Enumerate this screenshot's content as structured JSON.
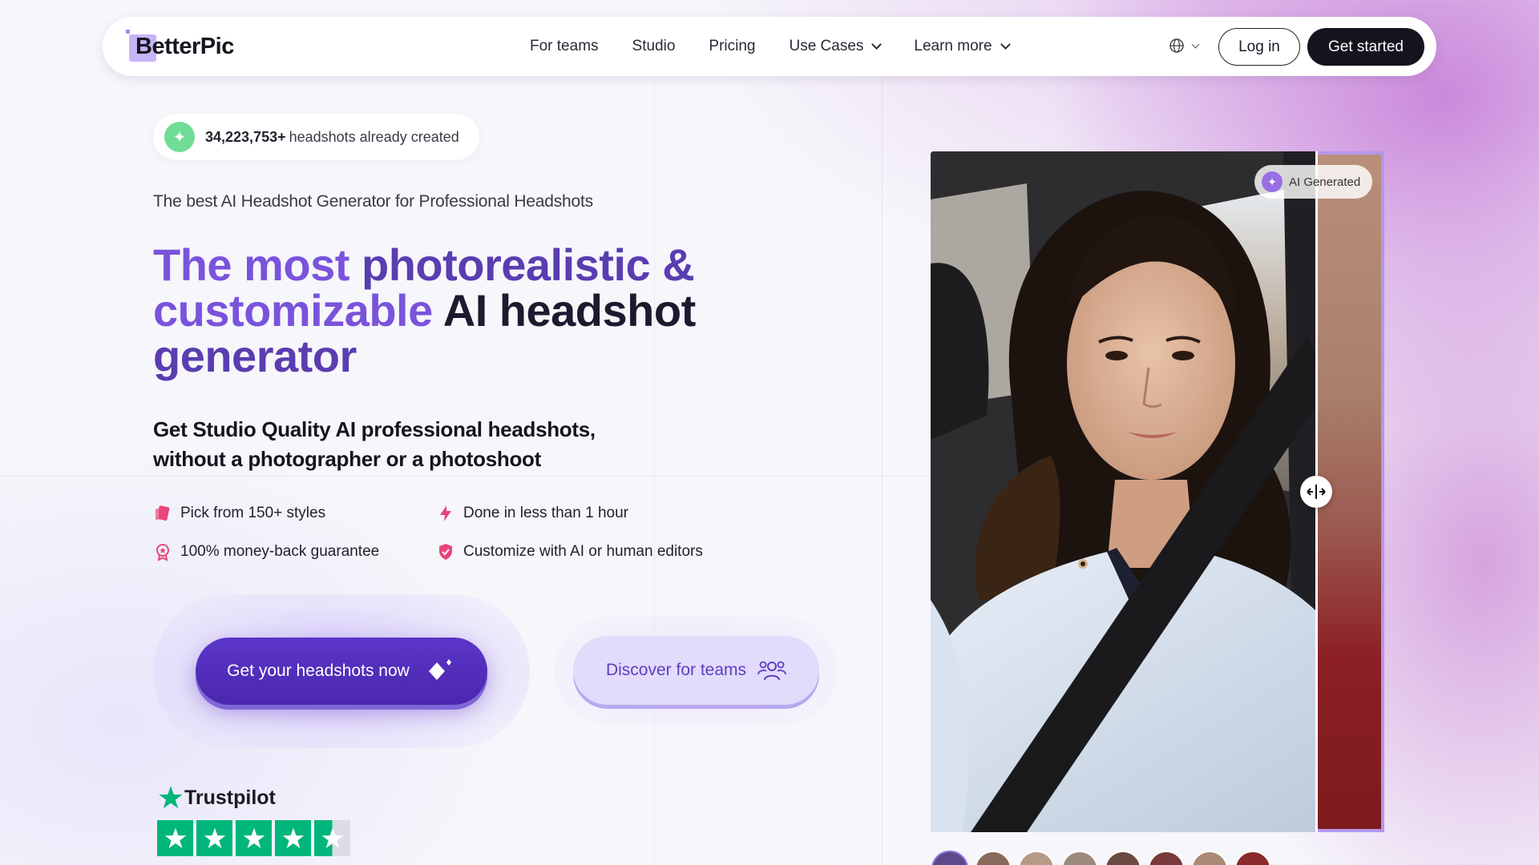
{
  "nav": {
    "brand": "BetterPic",
    "links": [
      {
        "label": "For teams",
        "dropdown": false
      },
      {
        "label": "Studio",
        "dropdown": false
      },
      {
        "label": "Pricing",
        "dropdown": false
      },
      {
        "label": "Use Cases",
        "dropdown": true
      },
      {
        "label": "Learn more",
        "dropdown": true
      }
    ],
    "language_icon": "globe-icon",
    "login_label": "Log in",
    "cta_label": "Get started"
  },
  "hero": {
    "counter_number": "34,223,753+",
    "counter_text": "headshots already created",
    "eyebrow": "The best AI Headshot Generator for Professional Headshots",
    "headline_part1": "The most",
    "headline_part2": " photorealistic &",
    "headline_part3": "customizable",
    "headline_part4": " AI headshot",
    "headline_part5": "generator",
    "subhead_line1": "Get Studio Quality AI professional headshots,",
    "subhead_line2": "without a photographer or a photoshoot",
    "features": [
      {
        "label": "Pick from 150+ styles",
        "icon": "palette-icon"
      },
      {
        "label": "Done in less than 1 hour",
        "icon": "lightning-icon"
      },
      {
        "label": "100% money-back guarantee",
        "icon": "award-icon"
      },
      {
        "label": "Customize with AI or human editors",
        "icon": "shield-icon"
      }
    ],
    "cta_primary": "Get your headshots now",
    "cta_secondary": "Discover for teams",
    "trustpilot_label": "Trustpilot",
    "trustpilot_rating": 4.5
  },
  "compare": {
    "ai_badge": "AI Generated",
    "slider_position": 0.85
  },
  "colors": {
    "accent": "#7a53db",
    "primary_button": "#4a27ae",
    "trustpilot_green": "#00b67a"
  }
}
